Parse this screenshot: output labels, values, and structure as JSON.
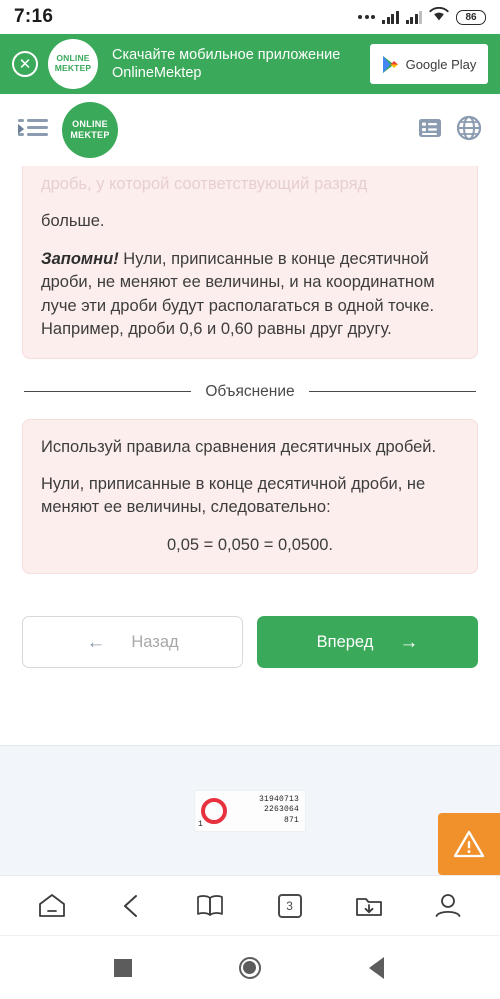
{
  "status_bar": {
    "time": "7:16",
    "battery_level": "86",
    "icons": [
      "more-dots-icon",
      "signal-bars-icon",
      "signal-bars-icon",
      "wifi-icon",
      "battery-icon"
    ]
  },
  "promo_banner": {
    "close_label": "✕",
    "logo_line1": "ONLINE",
    "logo_line2": "MEKTEP",
    "text": "Скачайте мобильное приложение OnlineMektep",
    "store_button_label": "Google Play",
    "background_color": "#3aa95a"
  },
  "app_bar": {
    "menu_icon": "format-indent-icon",
    "logo_line1": "ONLINE",
    "logo_line2": "MEKTEP",
    "list_icon": "list-view-icon",
    "language_icon": "globe-icon"
  },
  "content": {
    "rule_card": {
      "clipped_line": "дробь, у которой соответствующий разряд",
      "line_visible": "больше.",
      "remember_label": "Запомни!",
      "remember_text": " Нули, приписанные в конце десятичной дроби, не меняют ее величины, и на координатном луче эти дроби будут располагаться в одной точке. Например, дроби 0,6 и 0,60 равны друг другу."
    },
    "divider_label": "Объяснение",
    "explanation_card": {
      "para1": "Используй правила сравнения десятичных дробей.",
      "para2": "Нули, приписанные в конце десятичной дроби, не меняют ее величины, следовательно:",
      "equation": "0,05 = 0,050 = 0,0500."
    },
    "back_button": "Назад",
    "forward_button": "Вперед",
    "back_arrow": "←",
    "forward_arrow": "→",
    "accent_color": "#3aa95a",
    "card_color": "#fbeeed"
  },
  "ad": {
    "number_line1": "31940713",
    "number_line2": "2263064",
    "number_line3": "871",
    "corner_digit": "1",
    "ring_color": "#e8313f",
    "warning_icon": "warning-triangle-icon",
    "warning_color": "#f0912c"
  },
  "browser_bar": {
    "items": [
      {
        "name": "home-icon"
      },
      {
        "name": "back-chevron-icon"
      },
      {
        "name": "bookmarks-book-icon"
      },
      {
        "name": "tab-count-icon",
        "label": "3"
      },
      {
        "name": "downloads-folder-icon"
      },
      {
        "name": "profile-icon"
      }
    ]
  },
  "system_bar": {
    "recents": "recents-square-icon",
    "home": "home-circle-icon",
    "back": "back-triangle-icon"
  }
}
